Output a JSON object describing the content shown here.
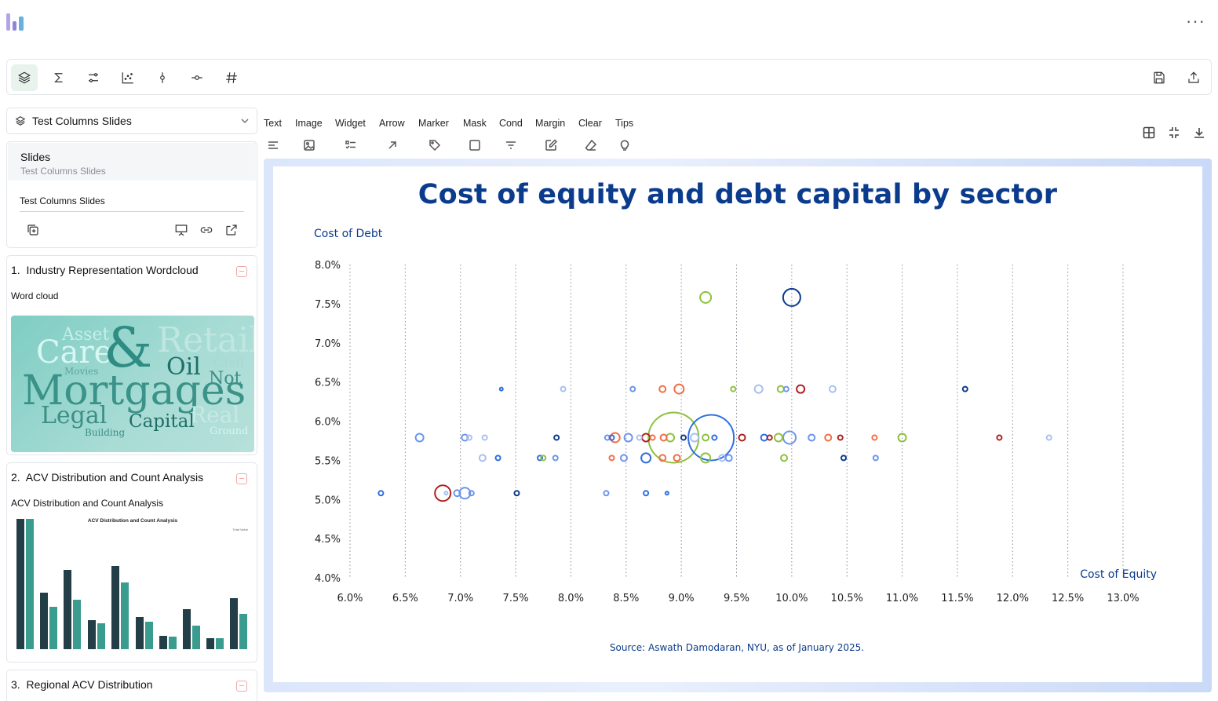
{
  "header": {
    "more_label": "···"
  },
  "toolbar": {
    "left_icons": [
      "layers-icon",
      "sigma-icon",
      "sliders-icon",
      "scatter-chart-icon",
      "vertical-node-icon",
      "horizontal-node-icon",
      "hash-icon"
    ],
    "right_icons": [
      "save-icon",
      "share-icon"
    ]
  },
  "sidebar": {
    "select_value": "Test Columns Slides",
    "slides_card": {
      "title": "Slides",
      "subtitle": "Test Columns Slides",
      "name_value": "Test Columns Slides"
    },
    "items": [
      {
        "number": "1.",
        "title": "Industry Representation Wordcloud",
        "subtitle": "Word cloud"
      },
      {
        "number": "2.",
        "title": "ACV Distribution and Count Analysis",
        "subtitle": "ACV Distribution and Count Analysis"
      },
      {
        "number": "3.",
        "title": "Regional ACV Distribution"
      }
    ],
    "wordcloud_words": [
      "Asset",
      "Care",
      "&",
      "Retail",
      "Oil",
      "Civil",
      "Movies",
      "Not",
      "Mortgages",
      "Legal",
      "Real",
      "Capital",
      "Building",
      "Ground"
    ],
    "thumb2_title": "ACV Distribution and Count Analysis",
    "thumb2_legend": "Total Value"
  },
  "insert_menu": {
    "items": [
      {
        "label": "Text",
        "icon": "align-left-icon"
      },
      {
        "label": "Image",
        "icon": "image-icon"
      },
      {
        "label": "Widget",
        "icon": "widget-list-icon"
      },
      {
        "label": "Arrow",
        "icon": "arrow-up-right-icon"
      },
      {
        "label": "Marker",
        "icon": "tag-icon"
      },
      {
        "label": "Mask",
        "icon": "square-icon"
      },
      {
        "label": "Cond",
        "icon": "filter-icon"
      },
      {
        "label": "Margin",
        "icon": "edit-box-icon"
      },
      {
        "label": "Clear",
        "icon": "eraser-icon"
      },
      {
        "label": "Tips",
        "icon": "lightbulb-icon"
      }
    ],
    "right_icons": [
      "grid-icon",
      "fit-icon",
      "download-icon"
    ]
  },
  "colors": {
    "navy": "#0b3b8c",
    "blue": "#2f6fe0",
    "lightblue": "#a9c0ef",
    "periwinkle": "#6d95ea",
    "orange": "#f07048",
    "red": "#b02020",
    "green": "#8ec13d"
  },
  "chart_data": {
    "type": "scatter",
    "title": "Cost of equity and debt capital by sector",
    "ylabel": "Cost of Debt",
    "xlabel": "Cost of Equity",
    "source": "Source: Aswath Damodaran, NYU, as of January 2025.",
    "xlim": [
      6.0,
      13.0
    ],
    "ylim": [
      4.0,
      8.0
    ],
    "x_ticks": [
      "6.0%",
      "6.5%",
      "7.0%",
      "7.5%",
      "8.0%",
      "8.5%",
      "9.0%",
      "9.5%",
      "10.0%",
      "10.5%",
      "11.0%",
      "11.5%",
      "12.0%",
      "12.5%",
      "13.0%"
    ],
    "y_ticks": [
      "4.0%",
      "4.5%",
      "5.0%",
      "5.5%",
      "6.0%",
      "6.5%",
      "7.0%",
      "7.5%",
      "8.0%"
    ],
    "grid": "vertical-dotted",
    "points": [
      {
        "x": 9.22,
        "y": 7.58,
        "r": 7,
        "color": "green"
      },
      {
        "x": 10.0,
        "y": 7.58,
        "r": 11,
        "color": "navy"
      },
      {
        "x": 7.37,
        "y": 6.41,
        "r": 2,
        "color": "blue"
      },
      {
        "x": 7.93,
        "y": 6.41,
        "r": 3,
        "color": "lightblue"
      },
      {
        "x": 8.56,
        "y": 6.41,
        "r": 3,
        "color": "periwinkle"
      },
      {
        "x": 8.83,
        "y": 6.41,
        "r": 4,
        "color": "orange"
      },
      {
        "x": 8.98,
        "y": 6.41,
        "r": 6,
        "color": "orange"
      },
      {
        "x": 9.47,
        "y": 6.41,
        "r": 3,
        "color": "green"
      },
      {
        "x": 9.7,
        "y": 6.41,
        "r": 5,
        "color": "lightblue"
      },
      {
        "x": 9.9,
        "y": 6.41,
        "r": 4,
        "color": "green"
      },
      {
        "x": 9.95,
        "y": 6.41,
        "r": 3,
        "color": "periwinkle"
      },
      {
        "x": 10.08,
        "y": 6.41,
        "r": 5,
        "color": "red"
      },
      {
        "x": 10.37,
        "y": 6.41,
        "r": 4,
        "color": "lightblue"
      },
      {
        "x": 11.57,
        "y": 6.41,
        "r": 3,
        "color": "navy"
      },
      {
        "x": 6.63,
        "y": 5.79,
        "r": 5,
        "color": "periwinkle"
      },
      {
        "x": 7.04,
        "y": 5.79,
        "r": 4,
        "color": "periwinkle"
      },
      {
        "x": 7.08,
        "y": 5.79,
        "r": 3,
        "color": "lightblue"
      },
      {
        "x": 7.22,
        "y": 5.79,
        "r": 3,
        "color": "lightblue"
      },
      {
        "x": 7.87,
        "y": 5.79,
        "r": 3,
        "color": "navy"
      },
      {
        "x": 8.33,
        "y": 5.79,
        "r": 3,
        "color": "periwinkle"
      },
      {
        "x": 8.37,
        "y": 5.79,
        "r": 3,
        "color": "blue"
      },
      {
        "x": 8.4,
        "y": 5.79,
        "r": 6,
        "color": "orange"
      },
      {
        "x": 8.52,
        "y": 5.79,
        "r": 5,
        "color": "periwinkle"
      },
      {
        "x": 8.62,
        "y": 5.79,
        "r": 3,
        "color": "lightblue"
      },
      {
        "x": 8.68,
        "y": 5.79,
        "r": 5,
        "color": "red"
      },
      {
        "x": 8.74,
        "y": 5.79,
        "r": 3,
        "color": "orange"
      },
      {
        "x": 8.84,
        "y": 5.79,
        "r": 4,
        "color": "orange"
      },
      {
        "x": 8.9,
        "y": 5.79,
        "r": 5,
        "color": "green"
      },
      {
        "x": 8.93,
        "y": 5.79,
        "r": 32,
        "color": "green"
      },
      {
        "x": 9.02,
        "y": 5.79,
        "r": 3,
        "color": "navy"
      },
      {
        "x": 9.12,
        "y": 5.79,
        "r": 5,
        "color": "lightblue"
      },
      {
        "x": 9.27,
        "y": 5.79,
        "r": 29,
        "color": "blue"
      },
      {
        "x": 9.22,
        "y": 5.79,
        "r": 4,
        "color": "green"
      },
      {
        "x": 9.3,
        "y": 5.79,
        "r": 3,
        "color": "blue"
      },
      {
        "x": 9.55,
        "y": 5.79,
        "r": 4,
        "color": "red"
      },
      {
        "x": 9.75,
        "y": 5.79,
        "r": 4,
        "color": "blue"
      },
      {
        "x": 9.8,
        "y": 5.79,
        "r": 3,
        "color": "red"
      },
      {
        "x": 9.88,
        "y": 5.79,
        "r": 5,
        "color": "green"
      },
      {
        "x": 9.98,
        "y": 5.79,
        "r": 8,
        "color": "periwinkle"
      },
      {
        "x": 10.18,
        "y": 5.79,
        "r": 4,
        "color": "periwinkle"
      },
      {
        "x": 10.33,
        "y": 5.79,
        "r": 4,
        "color": "orange"
      },
      {
        "x": 10.44,
        "y": 5.79,
        "r": 3,
        "color": "red"
      },
      {
        "x": 10.75,
        "y": 5.79,
        "r": 3,
        "color": "orange"
      },
      {
        "x": 11.0,
        "y": 5.79,
        "r": 5,
        "color": "green"
      },
      {
        "x": 11.88,
        "y": 5.79,
        "r": 3,
        "color": "red"
      },
      {
        "x": 12.33,
        "y": 5.79,
        "r": 3,
        "color": "lightblue"
      },
      {
        "x": 7.2,
        "y": 5.53,
        "r": 4,
        "color": "lightblue"
      },
      {
        "x": 7.34,
        "y": 5.53,
        "r": 3,
        "color": "blue"
      },
      {
        "x": 7.72,
        "y": 5.53,
        "r": 3,
        "color": "blue"
      },
      {
        "x": 7.75,
        "y": 5.53,
        "r": 3,
        "color": "green"
      },
      {
        "x": 7.86,
        "y": 5.53,
        "r": 3,
        "color": "periwinkle"
      },
      {
        "x": 8.37,
        "y": 5.53,
        "r": 3,
        "color": "orange"
      },
      {
        "x": 8.48,
        "y": 5.53,
        "r": 4,
        "color": "periwinkle"
      },
      {
        "x": 8.68,
        "y": 5.53,
        "r": 6,
        "color": "blue"
      },
      {
        "x": 8.83,
        "y": 5.53,
        "r": 4,
        "color": "orange"
      },
      {
        "x": 8.96,
        "y": 5.53,
        "r": 4,
        "color": "orange"
      },
      {
        "x": 9.22,
        "y": 5.53,
        "r": 6,
        "color": "green"
      },
      {
        "x": 9.37,
        "y": 5.53,
        "r": 4,
        "color": "lightblue"
      },
      {
        "x": 9.43,
        "y": 5.53,
        "r": 4,
        "color": "periwinkle"
      },
      {
        "x": 9.93,
        "y": 5.53,
        "r": 4,
        "color": "green"
      },
      {
        "x": 10.47,
        "y": 5.53,
        "r": 3,
        "color": "navy"
      },
      {
        "x": 10.76,
        "y": 5.53,
        "r": 3,
        "color": "periwinkle"
      },
      {
        "x": 6.28,
        "y": 5.08,
        "r": 3,
        "color": "blue"
      },
      {
        "x": 6.87,
        "y": 5.08,
        "r": 2,
        "color": "lightblue"
      },
      {
        "x": 6.84,
        "y": 5.08,
        "r": 10,
        "color": "red"
      },
      {
        "x": 6.97,
        "y": 5.08,
        "r": 4,
        "color": "periwinkle"
      },
      {
        "x": 7.04,
        "y": 5.08,
        "r": 7,
        "color": "periwinkle"
      },
      {
        "x": 7.1,
        "y": 5.08,
        "r": 3,
        "color": "periwinkle"
      },
      {
        "x": 7.51,
        "y": 5.08,
        "r": 3,
        "color": "navy"
      },
      {
        "x": 8.32,
        "y": 5.08,
        "r": 3,
        "color": "periwinkle"
      },
      {
        "x": 8.68,
        "y": 5.08,
        "r": 3,
        "color": "blue"
      },
      {
        "x": 8.87,
        "y": 5.08,
        "r": 2,
        "color": "blue"
      }
    ]
  }
}
